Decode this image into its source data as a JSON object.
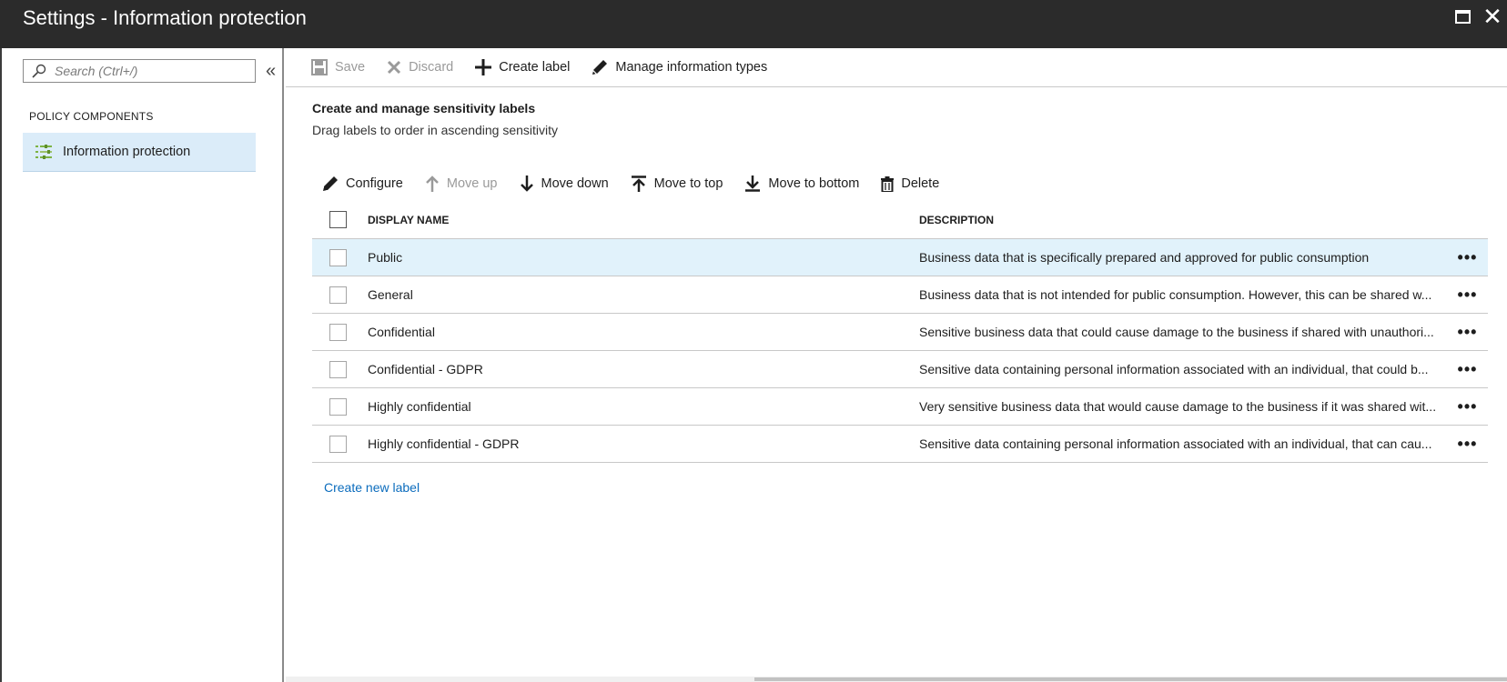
{
  "window": {
    "title": "Settings - Information protection",
    "maximize_icon": "maximize-icon",
    "close_icon": "close-icon"
  },
  "sidebar": {
    "search_placeholder": "Search (Ctrl+/)",
    "collapse_glyph": "«",
    "section_label": "POLICY COMPONENTS",
    "items": [
      {
        "label": "Information protection",
        "icon": "policy-list-icon",
        "selected": true
      }
    ]
  },
  "commandbar": {
    "save": "Save",
    "discard": "Discard",
    "create_label": "Create label",
    "manage_types": "Manage information types"
  },
  "content": {
    "heading": "Create and manage sensitivity labels",
    "subheading": "Drag labels to order in ascending sensitivity"
  },
  "actions": {
    "configure": "Configure",
    "move_up": "Move up",
    "move_down": "Move down",
    "move_to_top": "Move to top",
    "move_to_bottom": "Move to bottom",
    "delete": "Delete"
  },
  "table": {
    "columns": [
      "DISPLAY NAME",
      "DESCRIPTION"
    ],
    "more_glyph": "•••",
    "rows": [
      {
        "name": "Public",
        "description": "Business data that is specifically prepared and approved for public consumption"
      },
      {
        "name": "General",
        "description": "Business data that is not intended for public consumption. However, this can be shared w..."
      },
      {
        "name": "Confidential",
        "description": "Sensitive business data that could cause damage to the business if shared with unauthori..."
      },
      {
        "name": "Confidential - GDPR",
        "description": "Sensitive data containing personal information associated with an individual, that could b..."
      },
      {
        "name": "Highly confidential",
        "description": "Very sensitive business data that would cause damage to the business if it was shared wit..."
      },
      {
        "name": "Highly confidential - GDPR",
        "description": "Sensitive data containing personal information associated with an individual, that can cau..."
      }
    ]
  },
  "create_new_label": "Create new label",
  "colors": {
    "titlebar": "#2b2b2b",
    "selection": "#dbecf9",
    "row_highlight": "#e1f2fb",
    "link": "#0b6cbd"
  }
}
